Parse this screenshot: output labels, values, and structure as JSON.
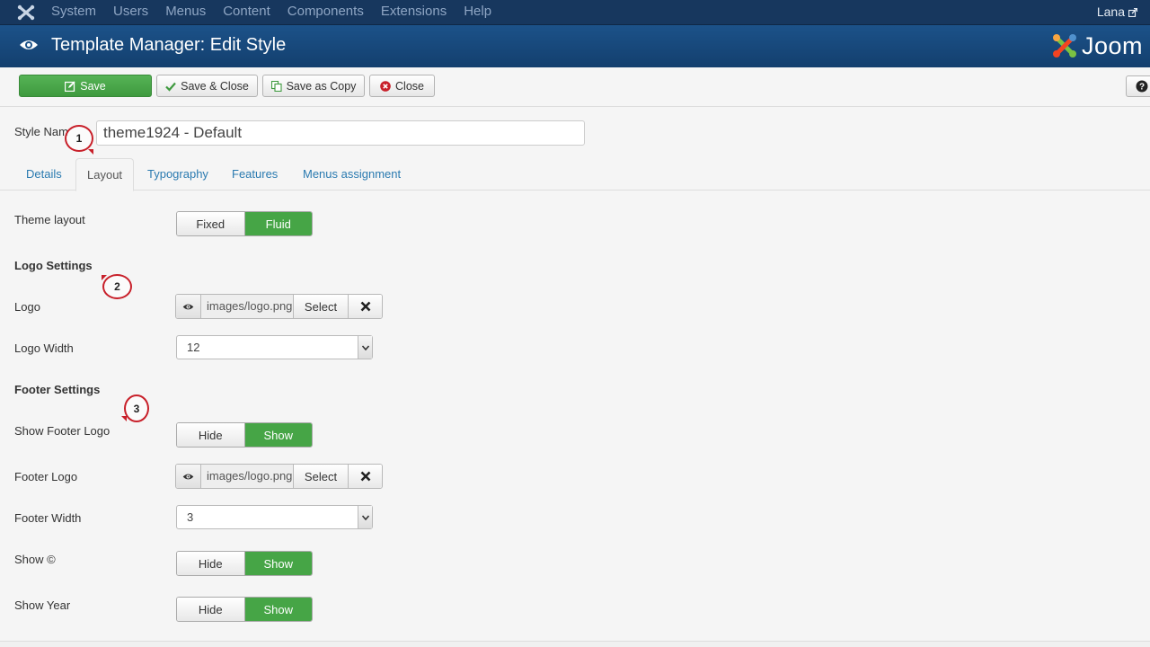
{
  "topnav": {
    "logo_icon": "joomla-x-icon",
    "items": [
      "System",
      "Users",
      "Menus",
      "Content",
      "Components",
      "Extensions",
      "Help"
    ],
    "user": "Lana"
  },
  "header": {
    "icon": "eye-icon",
    "title": "Template Manager: Edit Style",
    "brand": "Joom"
  },
  "toolbar": {
    "save": "Save",
    "save_close": "Save & Close",
    "save_copy": "Save as Copy",
    "close": "Close",
    "help_icon": "question-circle-icon"
  },
  "style_name": {
    "label": "Style Nam",
    "value": "theme1924 - Default"
  },
  "tabs": [
    "Details",
    "Layout",
    "Typography",
    "Features",
    "Menus assignment"
  ],
  "active_tab": "Layout",
  "form": {
    "theme_layout": {
      "label": "Theme layout",
      "options": [
        "Fixed",
        "Fluid"
      ],
      "selected": "Fluid"
    },
    "logo_section": "Logo Settings",
    "logo": {
      "label": "Logo",
      "path": "images/logo.png",
      "select": "Select"
    },
    "logo_width": {
      "label": "Logo Width",
      "value": "12"
    },
    "footer_section": "Footer Settings",
    "show_footer_logo": {
      "label": "Show Footer Logo",
      "options": [
        "Hide",
        "Show"
      ],
      "selected": "Show"
    },
    "footer_logo": {
      "label": "Footer Logo",
      "path": "images/logo.png",
      "select": "Select"
    },
    "footer_width": {
      "label": "Footer Width",
      "value": "3"
    },
    "show_copyright": {
      "label": "Show ©",
      "options": [
        "Hide",
        "Show"
      ],
      "selected": "Show"
    },
    "show_year": {
      "label": "Show Year",
      "options": [
        "Hide",
        "Show"
      ],
      "selected": "Show"
    }
  },
  "callouts": [
    "1",
    "2",
    "3"
  ],
  "colors": {
    "nav_bg": "#17375e",
    "header_bg": "#1c5289",
    "green": "#46a546",
    "link": "#2a7ab0",
    "callout_red": "#c8202a"
  }
}
